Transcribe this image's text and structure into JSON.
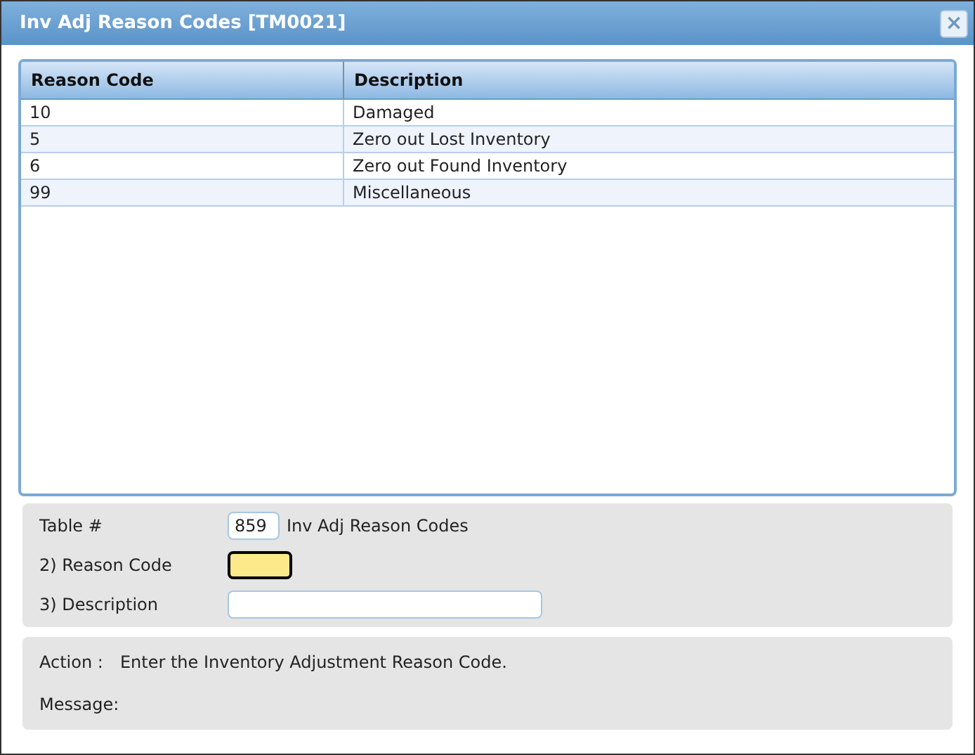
{
  "window": {
    "title": "Inv Adj Reason Codes [TM0021]",
    "close": "×"
  },
  "table": {
    "columns": [
      "Reason Code",
      "Description"
    ],
    "rows": [
      [
        "10",
        "Damaged"
      ],
      [
        "5",
        "Zero out Lost Inventory"
      ],
      [
        "6",
        "Zero out Found Inventory"
      ],
      [
        "99",
        "Miscellaneous"
      ]
    ]
  },
  "form": {
    "fields": [
      {
        "label": "Table #",
        "value": "859",
        "note": "Inv Adj Reason Codes",
        "kind": "short",
        "focused": false
      },
      {
        "label": "2) Reason Code",
        "kind": "short",
        "focused": true
      },
      {
        "label": "3) Description",
        "kind": "wide",
        "focused": false
      }
    ]
  },
  "status": {
    "action_label": "Action :",
    "action_text": "Enter the Inventory Adjustment Reason Code.",
    "message_label": "Message:"
  }
}
